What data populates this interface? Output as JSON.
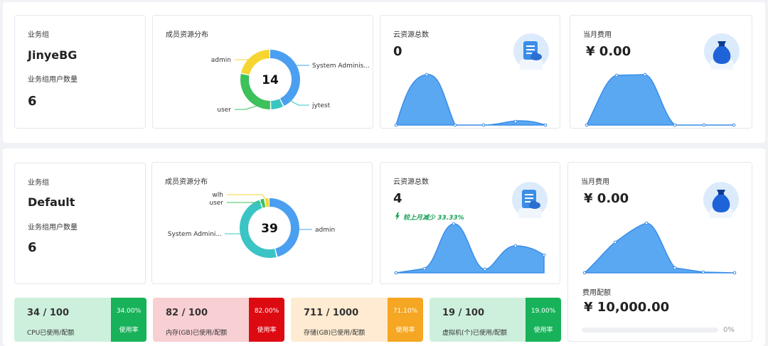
{
  "groups": [
    {
      "name_label": "业务组",
      "name": "JinyeBG",
      "user_count_label": "业务组用户数量",
      "user_count": "6",
      "distribution_title": "成员资源分布",
      "donut_total": "14",
      "donut_segments": [
        {
          "label": "System Adminis...",
          "value": 6,
          "color": "#4a9ff0"
        },
        {
          "label": "jytest",
          "value": 1,
          "color": "#3bc4c4"
        },
        {
          "label": "user",
          "value": 4,
          "color": "#3cc15b"
        },
        {
          "label": "admin",
          "value": 3,
          "color": "#f6d531"
        }
      ],
      "resources_title": "云资源总数",
      "resources_total": "0",
      "cost_title": "当月费用",
      "cost_value": "¥ 0.00"
    },
    {
      "name_label": "业务组",
      "name": "Default",
      "user_count_label": "业务组用户数量",
      "user_count": "6",
      "distribution_title": "成员资源分布",
      "donut_total": "39",
      "donut_segments": [
        {
          "label": "admin",
          "value": 18,
          "color": "#4a9ff0"
        },
        {
          "label": "System Admini...",
          "value": 19,
          "color": "#3bc4c4"
        },
        {
          "label": "user",
          "value": 1,
          "color": "#3cc15b"
        },
        {
          "label": "wlh",
          "value": 1,
          "color": "#f6d531"
        }
      ],
      "resources_title": "云资源总数",
      "resources_total": "4",
      "resources_trend": "较上月减少 33.33%",
      "cost_title": "当月费用",
      "cost_value": "¥ 0.00",
      "budget_label": "费用配额",
      "budget_value": "¥ 10,000.00",
      "budget_used_percent": "0%",
      "budget_used_fraction": 0
    }
  ],
  "quotas": [
    {
      "value": "34 / 100",
      "label": "CPU已使用/配额",
      "percent": "34.00%",
      "use_label": "使用率",
      "bg": "#cdf0dd",
      "accent": "#18b25a"
    },
    {
      "value": "82 / 100",
      "label": "内存(GB)已使用/配额",
      "percent": "82.00%",
      "use_label": "使用率",
      "bg": "#f8cfd2",
      "accent": "#dd0a12"
    },
    {
      "value": "711 / 1000",
      "label": "存储(GB)已使用/配额",
      "percent": "71.10%",
      "use_label": "使用率",
      "bg": "#feebd1",
      "accent": "#f5a623"
    },
    {
      "value": "19 / 100",
      "label": "虚拟机(个)已使用/配额",
      "percent": "19.00%",
      "use_label": "使用率",
      "bg": "#cdf0dd",
      "accent": "#18b25a"
    }
  ],
  "icons": {
    "resources": "cloud-document-icon",
    "cost": "money-bag-icon",
    "trend": "down-arrow-icon"
  },
  "colors": {
    "chart_fill": "#5aa8f2",
    "chart_stroke": "#3b8de8"
  }
}
